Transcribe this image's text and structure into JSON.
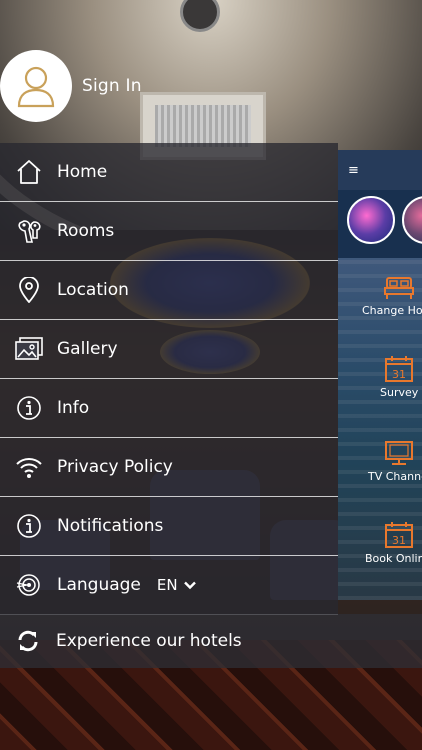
{
  "drawer": {
    "signin_label": "Sign In",
    "items": [
      {
        "label": "Home",
        "icon": "home-icon"
      },
      {
        "label": "Rooms",
        "icon": "keys-icon"
      },
      {
        "label": "Location",
        "icon": "location-pin-icon"
      },
      {
        "label": "Gallery",
        "icon": "gallery-icon"
      },
      {
        "label": "Info",
        "icon": "info-icon"
      },
      {
        "label": "Privacy Policy",
        "icon": "wifi-icon"
      },
      {
        "label": "Notifications",
        "icon": "info-icon"
      },
      {
        "label": "Language",
        "icon": "target-icon"
      }
    ],
    "language_value": "EN",
    "experience_label": "Experience our hotels"
  },
  "peek": {
    "menu_glyph": "≡",
    "tiles": [
      {
        "label": "Change Ho",
        "icon": "bed-icon"
      },
      {
        "label": "Survey",
        "icon": "calendar-icon",
        "icon_text": "31"
      },
      {
        "label": "TV Channe",
        "icon": "tv-icon"
      },
      {
        "label": "Book Onlin",
        "icon": "calendar-icon",
        "icon_text": "31"
      }
    ]
  },
  "colors": {
    "accent_orange": "#e8782d",
    "drawer_bg": "#282830"
  }
}
